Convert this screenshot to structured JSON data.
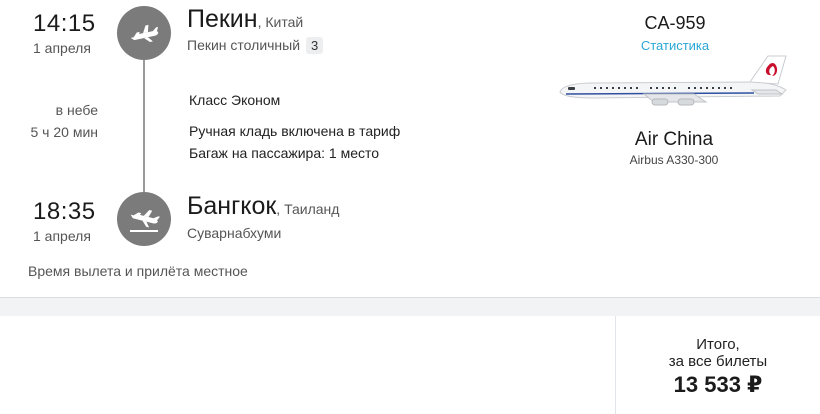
{
  "departure": {
    "time": "14:15",
    "date": "1 апреля",
    "city": "Пекин",
    "country": ", Китай",
    "airport": "Пекин столичный",
    "terminal": "3",
    "icon": "plane-takeoff-icon"
  },
  "inflight": {
    "label": "в небе",
    "duration": "5 ч 20 мин"
  },
  "fare": {
    "class": "Класс Эконом",
    "carry_on": "Ручная кладь включена в тариф",
    "baggage": "Багаж на пассажира: 1 место"
  },
  "arrival": {
    "time": "18:35",
    "date": "1 апреля",
    "city": "Бангкок",
    "country": ", Таиланд",
    "airport": "Суварнабхуми",
    "icon": "plane-landing-icon"
  },
  "note": "Время вылета и прилёта местное",
  "flight": {
    "number": "CA-959",
    "stats_link": "Статистика",
    "airline": "Air China",
    "aircraft": "Airbus A330-300",
    "livery_text": "AIR CHINA",
    "livery_color": "#c8102e"
  },
  "total": {
    "label_line1": "Итого,",
    "label_line2": "за все билеты",
    "price": "13 533 ₽"
  }
}
